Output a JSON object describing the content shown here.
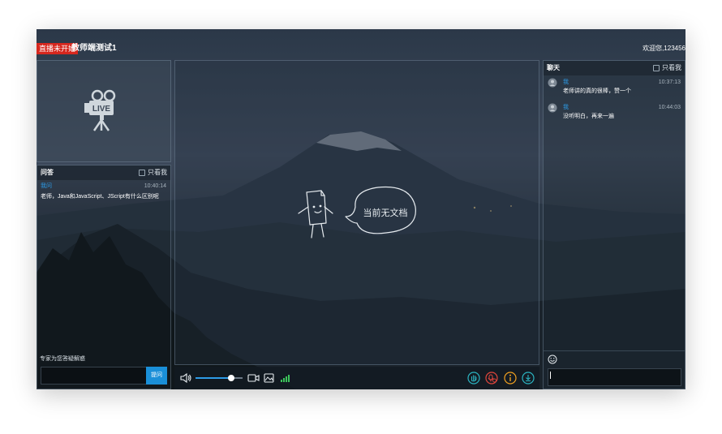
{
  "header": {
    "live_status": "直播未开始",
    "room_title": "教师端测试1",
    "welcome": "欢迎您,123456"
  },
  "qa": {
    "title": "问答",
    "only_me_label": "只看我",
    "messages": [
      {
        "user": "我问",
        "time": "10:40:14",
        "text": "老师，Java和JavaScript、JScript有什么区别呢"
      }
    ],
    "hint": "专家为您答疑解惑",
    "input_value": "",
    "submit_label": "提问"
  },
  "document": {
    "empty_text": "当前无文档"
  },
  "chat": {
    "title": "聊天",
    "only_me_label": "只看我",
    "messages": [
      {
        "user": "我",
        "time": "10:37:13",
        "text": "老师讲的真的很棒，赞一个"
      },
      {
        "user": "我",
        "time": "10:44:03",
        "text": "没听明白，再来一遍"
      }
    ],
    "input_value": ""
  },
  "player": {
    "volume_level": 0.75,
    "signal_bars": 4
  },
  "colors": {
    "accent": "#1a8fd8",
    "live_badge": "#d6271e",
    "username": "#2d9be6",
    "hand_icon": "#2bb3c0",
    "mic_icon": "#e0463c",
    "info_icon": "#f0a020",
    "download_icon": "#2bb3c0"
  },
  "icons": {
    "live_camera": "video-camera-icon",
    "speaker": "volume-icon",
    "camera": "camera-icon",
    "image": "image-icon",
    "signal": "signal-bars-icon",
    "hand": "raise-hand-icon",
    "mic": "microphone-icon",
    "info": "info-icon",
    "download": "download-icon",
    "emoji": "emoji-icon",
    "avatar": "user-avatar-icon"
  }
}
